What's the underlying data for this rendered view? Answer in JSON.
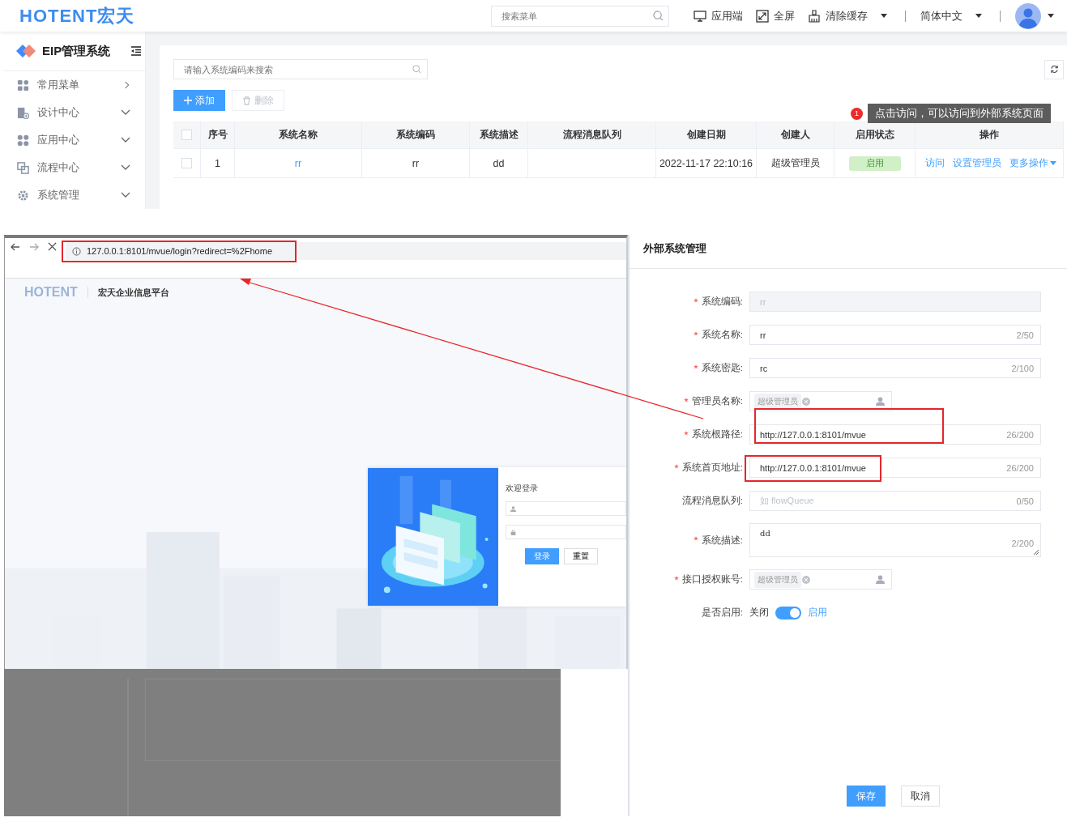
{
  "top": {
    "logo": "HOTENT宏天",
    "menu_search": {
      "placeholder": "搜索菜单"
    },
    "nav": [
      {
        "label": "应用端",
        "dropdown": false
      },
      {
        "label": "全屏",
        "dropdown": false
      },
      {
        "label": "清除缓存",
        "dropdown": true
      }
    ],
    "language": {
      "label": "简体中文",
      "dropdown": true
    },
    "sidebar": {
      "title": "EIP管理系统",
      "items": [
        {
          "label": "常用菜单",
          "kind": "popout"
        },
        {
          "label": "设计中心",
          "kind": "submenu"
        },
        {
          "label": "应用中心",
          "kind": "submenu"
        },
        {
          "label": "流程中心",
          "kind": "submenu"
        },
        {
          "label": "系统管理",
          "kind": "submenu"
        }
      ]
    },
    "search": {
      "placeholder": "请输入系统编码来搜索"
    },
    "buttons": [
      {
        "label": "添加",
        "kind": "add",
        "disabled": false
      },
      {
        "label": "删除",
        "kind": "delete",
        "disabled": true
      }
    ],
    "table": {
      "select_all_checked": false,
      "columns": [
        "序号",
        "系统名称",
        "系统编码",
        "系统描述",
        "流程消息队列",
        "创建日期",
        "创建人",
        "启用状态",
        "操作"
      ],
      "rows": [
        {
          "checked": false,
          "index": "1",
          "name": "rr",
          "code": "rr",
          "description": "dd",
          "queue": "",
          "created": "2022-11-17 22:10:16",
          "creator": "超级管理员",
          "status": {
            "label": "启用",
            "on": true
          },
          "actions": [
            {
              "label": "访问",
              "dropdown": false
            },
            {
              "label": "设置管理员",
              "dropdown": false
            },
            {
              "label": "更多操作",
              "dropdown": true
            }
          ]
        }
      ]
    },
    "tooltip": {
      "badge": "1",
      "text": "点击访问，可以访问到外部系统页面"
    }
  },
  "browser": {
    "url": "127.0.0.1:8101/mvue/login?redirect=%2Fhome",
    "logo": "HOTENT",
    "platform": "宏天企业信息平台",
    "login": {
      "title": "欢迎登录",
      "fields": [
        {
          "kind": "user"
        },
        {
          "kind": "password"
        }
      ],
      "buttons": [
        {
          "label": "登录",
          "primary": true
        },
        {
          "label": "重置",
          "primary": false
        }
      ]
    }
  },
  "form": {
    "title": "外部系统管理",
    "fields": [
      {
        "label": "系统编码:",
        "required": true,
        "kind": "input",
        "value": "rr",
        "disabled": true
      },
      {
        "label": "系统名称:",
        "required": true,
        "kind": "input",
        "value": "rr",
        "counter": "2/50",
        "disabled": false
      },
      {
        "label": "系统密匙:",
        "required": true,
        "kind": "input",
        "value": "rc",
        "counter": "2/100",
        "disabled": false
      },
      {
        "label": "管理员名称:",
        "required": true,
        "kind": "tags",
        "tag": "超级管理员"
      },
      {
        "label": "系统根路径:",
        "required": true,
        "kind": "input",
        "value": "http://127.0.0.1:8101/mvue",
        "counter": "26/200",
        "disabled": false
      },
      {
        "label": "系统首页地址:",
        "required": true,
        "kind": "input",
        "value": "http://127.0.0.1:8101/mvue",
        "counter": "26/200",
        "disabled": false
      },
      {
        "label": "流程消息队列:",
        "required": false,
        "kind": "input",
        "placeholder": "如  flowQueue",
        "counter": "0/50",
        "disabled": false
      },
      {
        "label": "系统描述:",
        "required": true,
        "kind": "textarea",
        "value": "dd",
        "counter": "2/200"
      },
      {
        "label": "接口授权账号:",
        "required": true,
        "kind": "tags",
        "tag": "超级管理员"
      },
      {
        "label": "是否启用:",
        "required": false,
        "kind": "switch",
        "on": true,
        "off_label": "关闭",
        "on_label": "启用"
      }
    ],
    "buttons": [
      {
        "label": "保存",
        "primary": true
      },
      {
        "label": "取消",
        "primary": false
      }
    ]
  }
}
